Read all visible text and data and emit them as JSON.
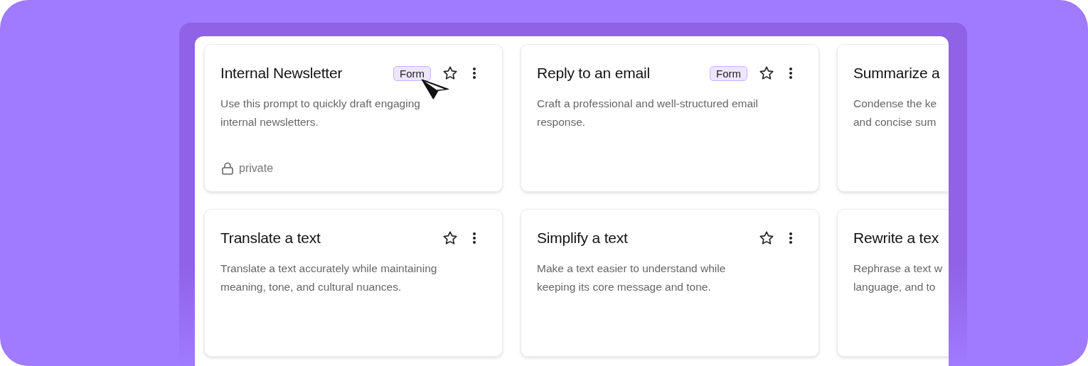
{
  "cards": [
    {
      "kind": "full",
      "title": "Internal Newsletter",
      "badge": "Form",
      "description_lines": [
        "Use this prompt to quickly draft engaging",
        "internal newsletters."
      ],
      "footer": "private"
    },
    {
      "kind": "full",
      "title": "Reply to an email",
      "badge": "Form",
      "description_lines": [
        "Craft a professional and well-structured email",
        "response."
      ]
    },
    {
      "kind": "cut",
      "title": "Summarize a",
      "description_lines": [
        "Condense the ke",
        "and concise sum"
      ]
    },
    {
      "kind": "full",
      "title": "Translate a text",
      "description_lines": [
        "Translate a text accurately while maintaining",
        "meaning, tone, and cultural nuances."
      ]
    },
    {
      "kind": "full",
      "title": "Simplify a text",
      "description_lines": [
        "Make a text easier to understand while",
        "keeping its core message and tone."
      ]
    },
    {
      "kind": "cut",
      "title": "Rewrite a tex",
      "description_lines": [
        "Rephrase a text w",
        "language, and to"
      ]
    }
  ]
}
